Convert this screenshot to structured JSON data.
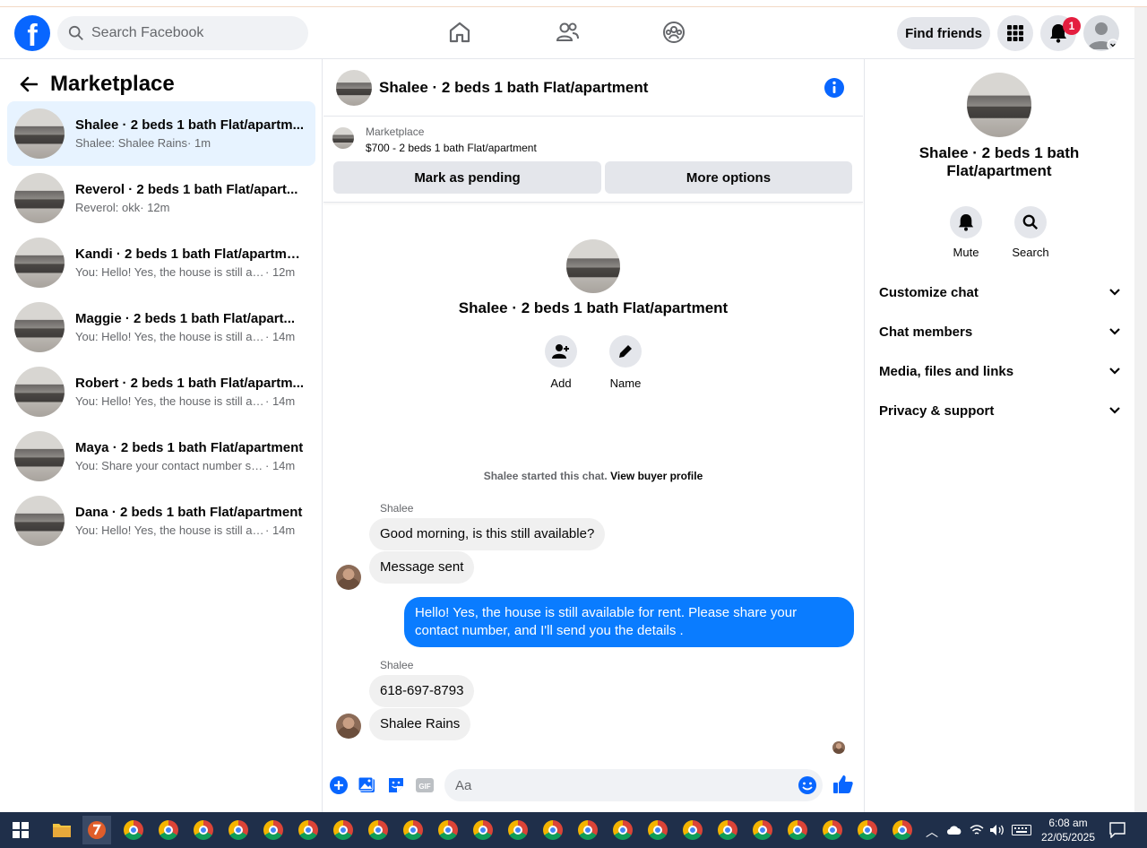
{
  "topbar": {
    "search_placeholder": "Search Facebook",
    "find_friends": "Find friends",
    "notifications_count": "1",
    "logo_letter": "f"
  },
  "left": {
    "title": "Marketplace",
    "conversations": [
      {
        "name": "Shalee · 2 beds 1 bath Flat/apartm...",
        "snippet": "Shalee: Shalee Rains",
        "time": "· 1m",
        "active": true
      },
      {
        "name": "Reverol · 2 beds 1 bath Flat/apart...",
        "snippet": "Reverol: okk",
        "time": "· 12m"
      },
      {
        "name": "Kandi · 2 beds 1 bath Flat/apartment",
        "snippet": "You: Hello! Yes, the house is still avai...",
        "time": "· 12m"
      },
      {
        "name": "Maggie · 2 beds 1 bath Flat/apart...",
        "snippet": "You: Hello! Yes, the house is still avai...",
        "time": "· 14m"
      },
      {
        "name": "Robert · 2 beds 1 bath Flat/apartm...",
        "snippet": "You: Hello! Yes, the house is still avai...",
        "time": "· 14m"
      },
      {
        "name": "Maya · 2 beds 1 bath Flat/apartment",
        "snippet": "You: Share your contact number so ...",
        "time": "· 14m"
      },
      {
        "name": "Dana · 2 beds 1 bath Flat/apartment",
        "snippet": "You: Hello! Yes, the house is still avai...",
        "time": "· 14m"
      }
    ]
  },
  "chat": {
    "header_title": "Shalee · 2 beds 1 bath Flat/apartment",
    "marketplace_label": "Marketplace",
    "listing": "$700 - 2 beds 1 bath Flat/apartment",
    "mark_pending": "Mark as pending",
    "more_options": "More options",
    "intro_title": "Shalee · 2 beds 1 bath Flat/apartment",
    "add_label": "Add",
    "name_label": "Name",
    "started_text": "Shalee started this chat.",
    "view_profile": "View buyer profile",
    "sender1": "Shalee",
    "msg1": "Good morning, is this still available?",
    "msg2": "Message sent",
    "msg3": "Hello! Yes, the house is still available for rent. Please share your contact number, and I'll send you the details .",
    "sender2": "Shalee",
    "msg4": "618-697-8793",
    "msg5": "Shalee Rains",
    "composer_placeholder": "Aa"
  },
  "details": {
    "title": "Shalee · 2 beds 1 bath Flat/apartment",
    "mute": "Mute",
    "search": "Search",
    "sections": [
      "Customize chat",
      "Chat members",
      "Media, files and links",
      "Privacy & support"
    ]
  },
  "taskbar": {
    "time": "6:08 am",
    "date": "22/05/2025"
  },
  "colors": {
    "accent": "#0866ff",
    "bubble_me": "#0a7cff",
    "active_row": "#e7f3ff",
    "badge": "#e41e3f"
  }
}
